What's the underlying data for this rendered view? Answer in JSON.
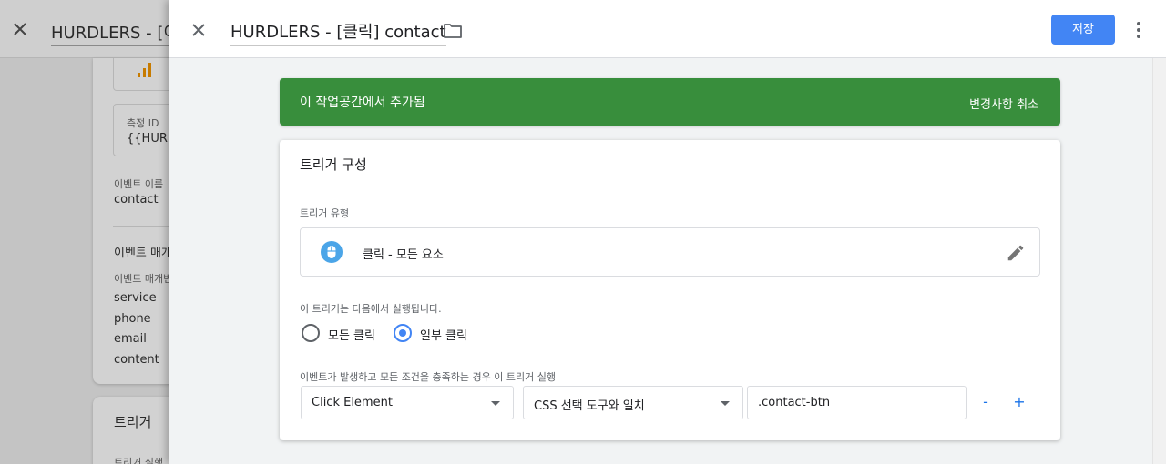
{
  "background": {
    "title": "HURDLERS - [이",
    "measurement_id_label": "측정 ID",
    "measurement_id_value": "{{HURD",
    "event_name_label": "이벤트 이름",
    "event_name_value": "contact",
    "event_params_heading": "이벤트 매개",
    "event_params_label": "이벤트 매개변",
    "event_params": [
      "service",
      "phone",
      "email",
      "content"
    ],
    "triggers_heading": "트리거",
    "triggers_sub": "트리거 실행"
  },
  "header": {
    "title": "HURDLERS - [클릭] contact",
    "save_label": "저장"
  },
  "banner": {
    "text": "이 작업공간에서 추가됨",
    "undo_label": "변경사항 취소",
    "color": "#388e3c"
  },
  "trigger": {
    "card_title": "트리거 구성",
    "type_label": "트리거 유형",
    "type_value": "클릭 - 모든 요소",
    "type_icon": "mouse-icon",
    "fires_on_label": "이 트리거는 다음에서 실행됩니다.",
    "options": [
      {
        "label": "모든 클릭",
        "selected": false
      },
      {
        "label": "일부 클릭",
        "selected": true
      }
    ],
    "condition_label": "이벤트가 발생하고 모든 조건을 충족하는 경우 이 트리거 실행",
    "condition": {
      "variable": "Click Element",
      "operator": "CSS 선택 도구와 일치",
      "value": ".contact-btn"
    },
    "remove_label": "-",
    "add_label": "+"
  },
  "colors": {
    "accent": "#4285f4",
    "success": "#388e3c",
    "link": "#1a73e8"
  }
}
